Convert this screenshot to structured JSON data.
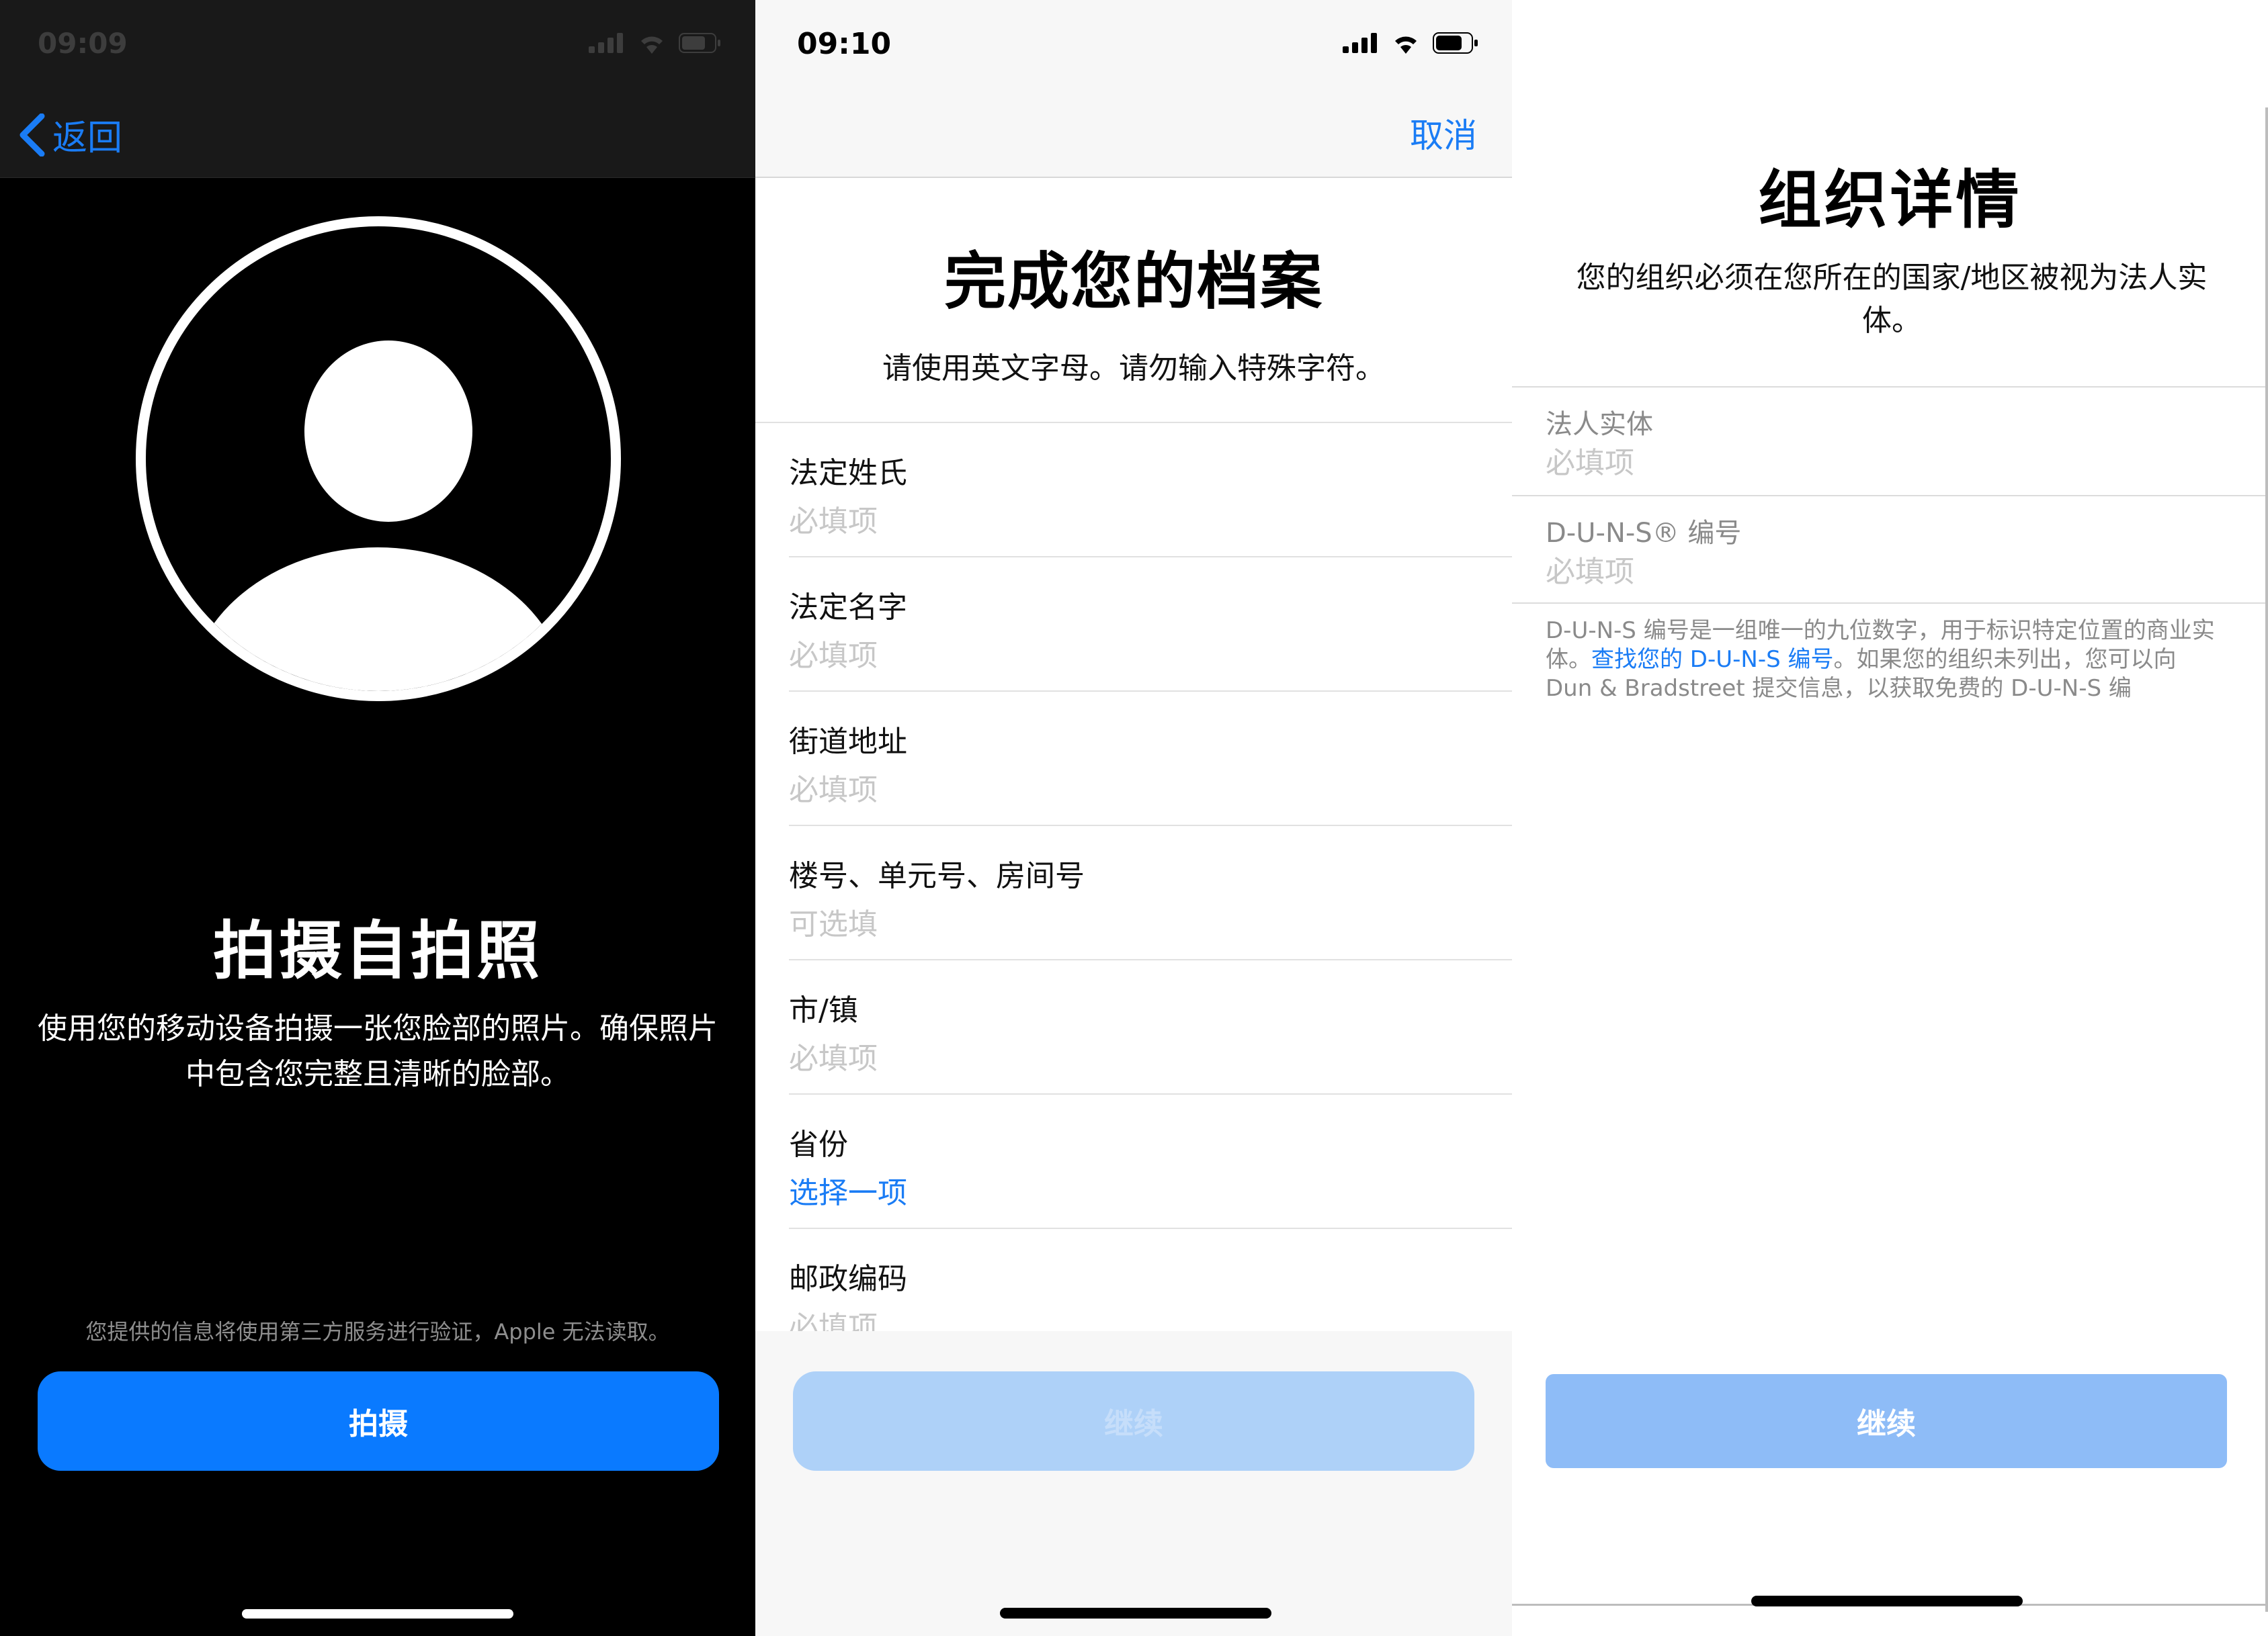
{
  "selfie": {
    "time": "09:09",
    "back_label": "返回",
    "title": "拍摄自拍照",
    "description": "使用您的移动设备拍摄一张您脸部的照片。确保照片中包含您完整且清晰的脸部。",
    "note": "您提供的信息将使用第三方服务进行验证，Apple 无法读取。",
    "button": "拍摄",
    "accent": "#0a7aff"
  },
  "profile": {
    "time": "09:10",
    "cancel_label": "取消",
    "title": "完成您的档案",
    "subtitle": "请使用英文字母。请勿输入特殊字符。",
    "fields": [
      {
        "label": "法定姓氏",
        "value": "必填项"
      },
      {
        "label": "法定名字",
        "value": "必填项"
      },
      {
        "label": "街道地址",
        "value": "必填项"
      },
      {
        "label": "楼号、单元号、房间号",
        "value": "可选填"
      },
      {
        "label": "市/镇",
        "value": "必填项"
      },
      {
        "label": "省份",
        "value": "选择一项"
      },
      {
        "label": "邮政编码",
        "value": "必填项"
      }
    ],
    "button": "继续"
  },
  "organization": {
    "title": "组织详情",
    "description": "您的组织必须在您所在的国家/地区被视为法人实体。",
    "fields": [
      {
        "label": "法人实体",
        "value": "必填项"
      },
      {
        "label": "D-U-N-S® 编号",
        "value": "必填项"
      }
    ],
    "note_before": "D-U-N-S 编号是一组唯一的九位数字，用于标识特定位置的商业实体。",
    "note_link": "查找您的 D-U-N-S 编号",
    "note_after": "。如果您的组织未列出，您可以向 Dun & Bradstreet 提交信息，以获取免费的 D-U-N-S 编",
    "button": "继续"
  }
}
